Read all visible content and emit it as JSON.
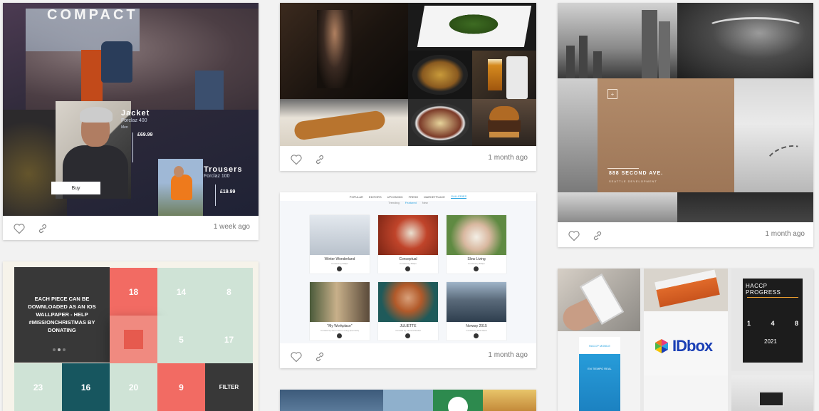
{
  "cards": {
    "compact": {
      "brand": "COMPACT",
      "product1": {
        "name": "Jacket",
        "model": "Forclaz 400",
        "size": "Men",
        "price": "£69.99"
      },
      "product2": {
        "name": "Trousers",
        "model": "Forclaz 100",
        "price": "£19.99"
      },
      "buy_label": "Buy",
      "time": "1 week ago"
    },
    "restaurant": {
      "time": "1 month ago"
    },
    "seattle": {
      "address": "888 SECOND AVE.",
      "developer": "SEATTLE DEVELOPMENT",
      "time": "1 month ago"
    },
    "mission": {
      "message": "EACH PIECE CAN BE DOWNLOADED AS AN IOS WALLPAPER - HELP #MISSIONCHRISTMAS BY DONATING",
      "cells": [
        "18",
        "14",
        "8",
        "5",
        "17",
        "23",
        "16",
        "20",
        "9",
        "FILTER"
      ]
    },
    "gallery": {
      "nav": [
        "POPULAR",
        "EDITORS",
        "UPCOMING",
        "FRESH",
        "MARKETPLACE",
        "GALLERIES"
      ],
      "subnav": [
        "Trending",
        "Featured",
        "New"
      ],
      "tiles": [
        {
          "title": "Winter Wonderland",
          "by": "Curated by 500px"
        },
        {
          "title": "Conceptual",
          "by": "Curated by 500px"
        },
        {
          "title": "Slow Living",
          "by": "Curated by 500px"
        },
        {
          "title": "\"My Workplace\"",
          "by": "Curated by Kenn Chen Leung (Kenneth)"
        },
        {
          "title": "JULIETTE",
          "by": "Curated by Laurent Bredel"
        },
        {
          "title": "Norway 2015",
          "by": "Curated by Rob Ward"
        }
      ],
      "time": "1 month ago"
    },
    "idbox": {
      "progress_title": "HACCP PROGRESS",
      "nums": [
        "1",
        "4",
        "8"
      ],
      "year": "2021",
      "logo_text": "IDbox",
      "banner_header": "HACCP MOBILE",
      "banner_sub": "EN TIEMPO REAL"
    }
  },
  "icons": {
    "like": "heart-icon",
    "share": "link-icon"
  },
  "colors": {
    "coral": "#f26b63",
    "mint": "#cfe3d6",
    "teal": "#17565f",
    "dark": "#383838",
    "tan": "#b38c6b"
  }
}
